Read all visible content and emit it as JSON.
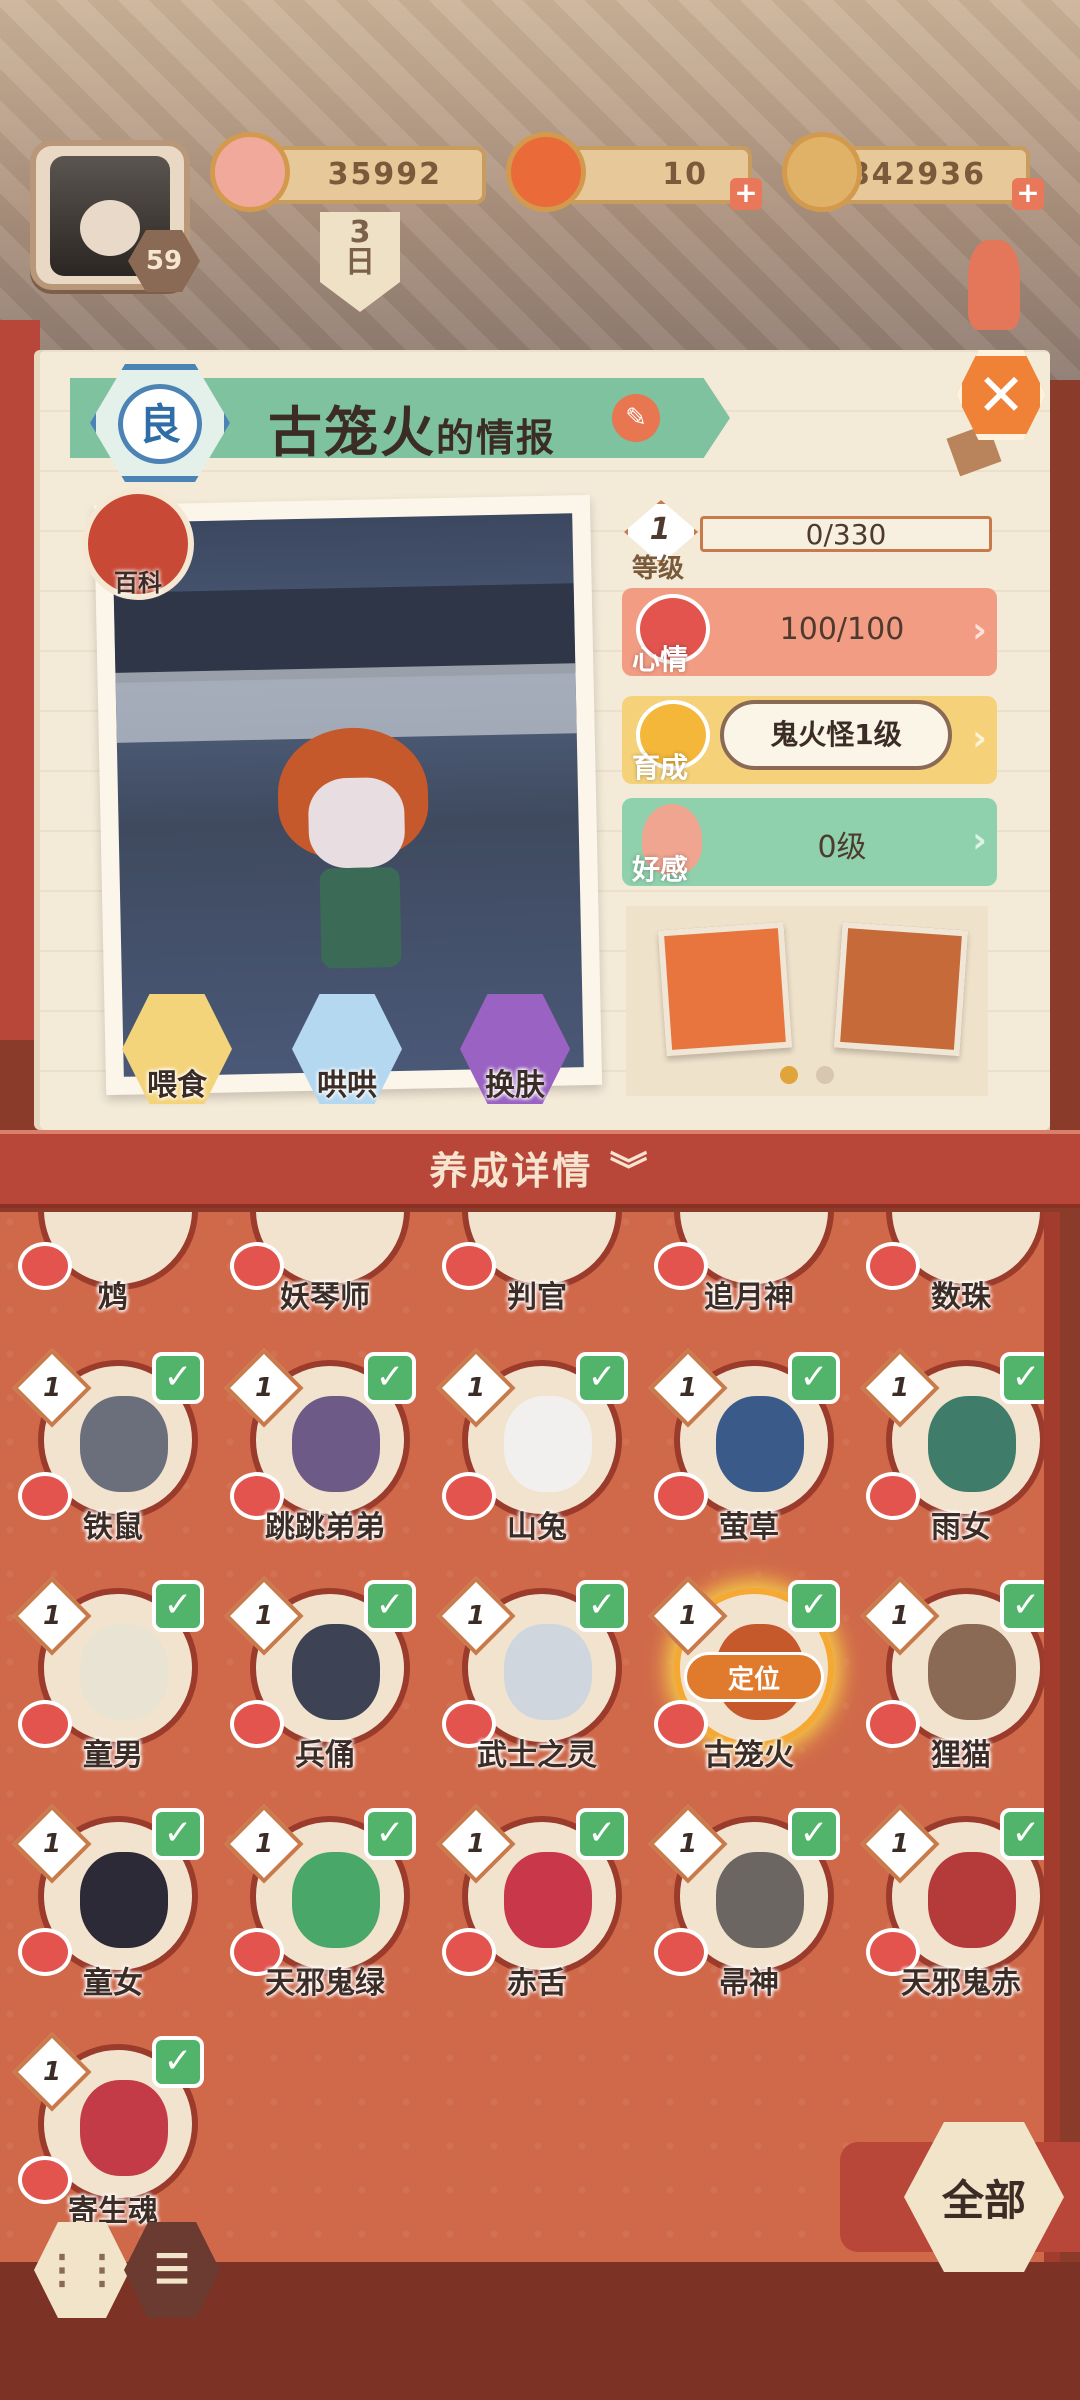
{
  "topbar": {
    "player_level": "59",
    "currency_gold": "35992",
    "currency_fire": "10",
    "currency_coin": "842936",
    "day_number": "3",
    "day_unit": "日"
  },
  "info": {
    "rank_label": "良",
    "name": "古笼火",
    "name_suffix": "的情报",
    "close_label": "✕",
    "wiki_label": "百科"
  },
  "actions": [
    {
      "label": "喂食"
    },
    {
      "label": "哄哄"
    },
    {
      "label": "换肤"
    }
  ],
  "stats": {
    "level": {
      "label": "等级",
      "value": "1",
      "exp": "0/330"
    },
    "mood": {
      "label": "心情",
      "value": "100/100"
    },
    "growth": {
      "label": "育成",
      "value": "鬼火怪1级"
    },
    "affinity": {
      "label": "好感",
      "value": "0级"
    }
  },
  "detail_header": {
    "label": "养成详情",
    "icon": "double-chevron-down-icon"
  },
  "heroes_partial": [
    {
      "name": "鸩"
    },
    {
      "name": "妖琴师"
    },
    {
      "name": "判官"
    },
    {
      "name": "追月神"
    },
    {
      "name": "数珠"
    }
  ],
  "heroes": [
    {
      "name": "铁鼠",
      "level": "1",
      "color": "#6b6f7c"
    },
    {
      "name": "跳跳弟弟",
      "level": "1",
      "color": "#6d5a86"
    },
    {
      "name": "山兔",
      "level": "1",
      "color": "#f2f0ee"
    },
    {
      "name": "萤草",
      "level": "1",
      "color": "#3a5a8a"
    },
    {
      "name": "雨女",
      "level": "1",
      "color": "#3f7c6a"
    },
    {
      "name": "童男",
      "level": "1",
      "color": "#e9e3d4"
    },
    {
      "name": "兵俑",
      "level": "1",
      "color": "#3d4354"
    },
    {
      "name": "武士之灵",
      "level": "1",
      "color": "#cfd6de"
    },
    {
      "name": "古笼火",
      "level": "1",
      "color": "#c5592b",
      "selected": true,
      "badge": "定位"
    },
    {
      "name": "狸猫",
      "level": "1",
      "color": "#8a6a54"
    },
    {
      "name": "童女",
      "level": "1",
      "color": "#2b2a36"
    },
    {
      "name": "天邪鬼绿",
      "level": "1",
      "color": "#4aa76a"
    },
    {
      "name": "赤舌",
      "level": "1",
      "color": "#c8384a"
    },
    {
      "name": "帚神",
      "level": "1",
      "color": "#6c6663"
    },
    {
      "name": "天邪鬼赤",
      "level": "1",
      "color": "#b53a3a"
    },
    {
      "name": "寄生魂",
      "level": "1",
      "color": "#c33b46"
    }
  ],
  "bottom": {
    "filter_label": "全部",
    "grid_view_icon": "grid-view-icon",
    "list_view_icon": "list-view-icon"
  }
}
